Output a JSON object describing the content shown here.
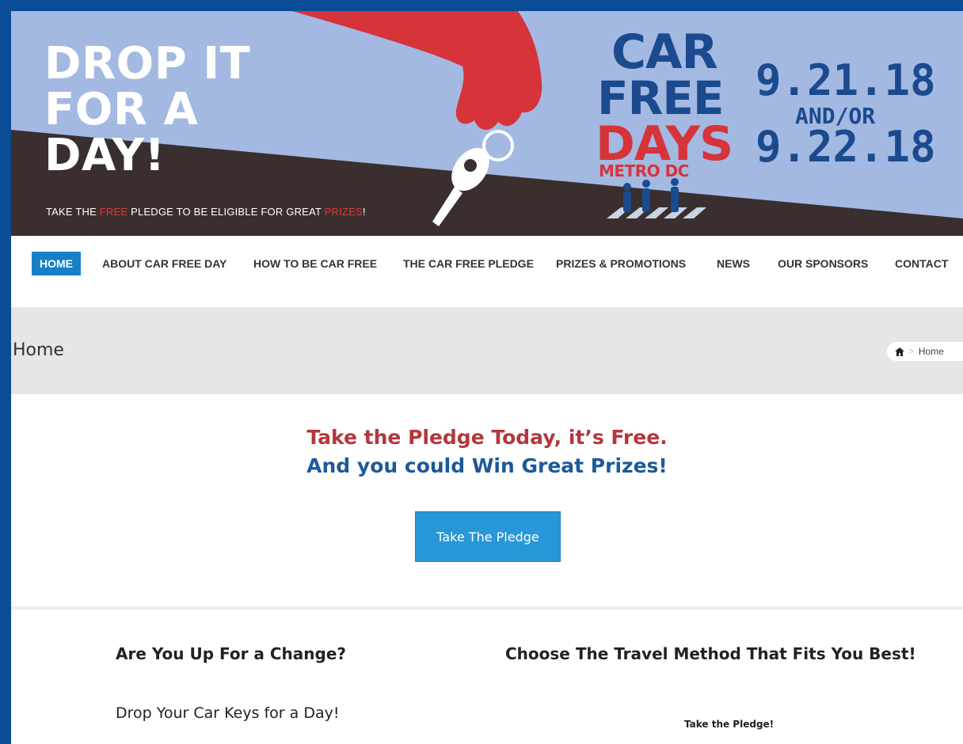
{
  "banner": {
    "headline_line1": "DROP IT",
    "headline_line2": "FOR A",
    "headline_line3": "DAY!",
    "tagline_part1": "TAKE THE ",
    "tagline_free": "FREE",
    "tagline_part2": " PLEDGE TO BE ELIGIBLE FOR GREAT ",
    "tagline_prizes": "PRIZES",
    "tagline_end": "!",
    "logo_car": "CAR",
    "logo_free": "FREE",
    "logo_days": "DAYS",
    "logo_metro": "METRO DC",
    "date1": "9.21.18",
    "and_or": "AND/OR",
    "date2": "9.22.18",
    "colors": {
      "sky": "#a3b9e2",
      "road": "#3a2f2e",
      "hand": "#d7333b",
      "logo_blue": "#1b4a8e"
    }
  },
  "nav": {
    "items": [
      {
        "label": "HOME",
        "active": true
      },
      {
        "label": "ABOUT CAR FREE DAY"
      },
      {
        "label": "HOW TO BE CAR FREE"
      },
      {
        "label": "THE CAR FREE PLEDGE"
      },
      {
        "label": "PRIZES & PROMOTIONS"
      },
      {
        "label": "NEWS"
      },
      {
        "label": "OUR SPONSORS"
      },
      {
        "label": "CONTACT"
      }
    ],
    "active_color": "#1780c7"
  },
  "titlebar": {
    "title": "Home",
    "breadcrumb_icon": "home-icon",
    "breadcrumb_label": "Home"
  },
  "main": {
    "hero_line1": "Take the Pledge Today, it’s Free.",
    "hero_line2": "And you could Win Great Prizes!",
    "pledge_button": "Take The Pledge",
    "left_heading": "Are You Up For a Change?",
    "right_heading": "Choose The Travel Method That Fits You Best!",
    "left_text": "Drop Your Car Keys for a Day!",
    "right_text": "Take the Pledge!"
  }
}
